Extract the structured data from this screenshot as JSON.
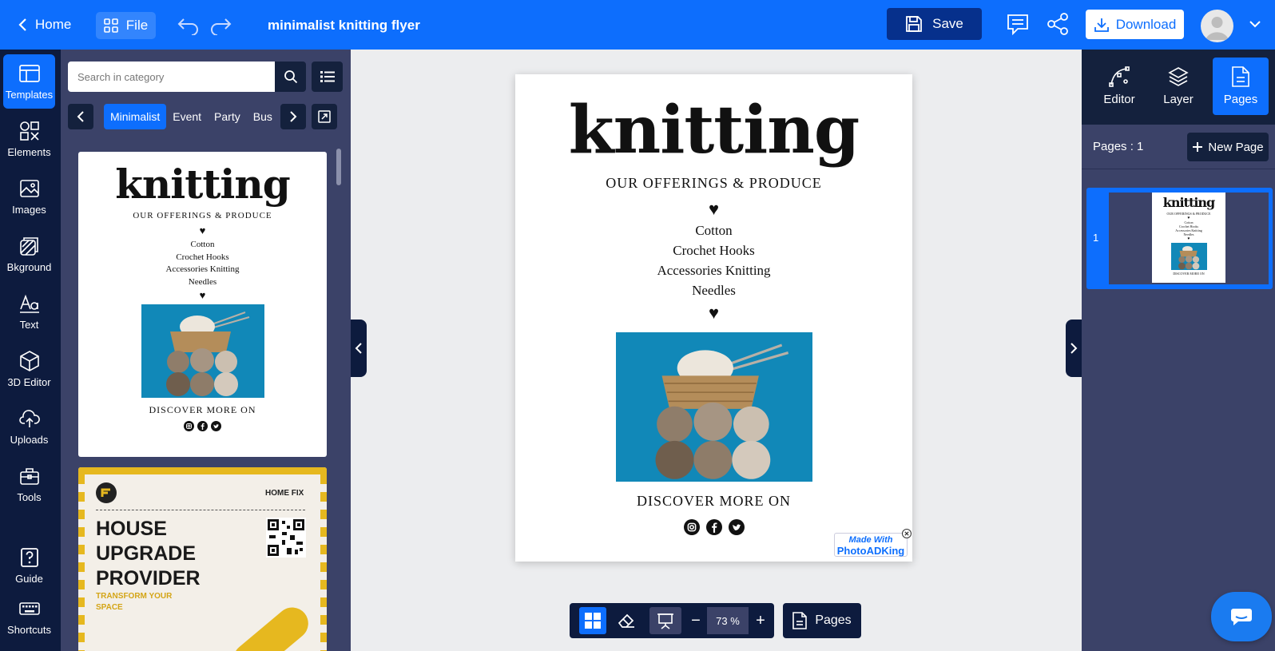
{
  "topbar": {
    "home_label": "Home",
    "file_label": "File",
    "doc_title": "minimalist knitting flyer",
    "save_label": "Save",
    "download_label": "Download"
  },
  "rail": {
    "items": [
      {
        "label": "Templates",
        "icon": "templates-icon"
      },
      {
        "label": "Elements",
        "icon": "elements-icon"
      },
      {
        "label": "Images",
        "icon": "images-icon"
      },
      {
        "label": "Bkground",
        "icon": "background-icon"
      },
      {
        "label": "Text",
        "icon": "text-icon"
      },
      {
        "label": "3D Editor",
        "icon": "cube-icon"
      },
      {
        "label": "Uploads",
        "icon": "upload-icon"
      },
      {
        "label": "Tools",
        "icon": "toolbox-icon"
      }
    ],
    "guide_label": "Guide",
    "shortcuts_label": "Shortcuts"
  },
  "panel": {
    "search_placeholder": "Search in category",
    "categories": [
      "Minimalist",
      "Event",
      "Party",
      "Bus"
    ],
    "card2": {
      "brand": "HOME FIX",
      "headline": [
        "HOUSE",
        "UPGRADE",
        "PROVIDER"
      ],
      "tagline": [
        "TRANSFORM YOUR",
        "SPACE"
      ]
    }
  },
  "flyer": {
    "title": "knitting",
    "subtitle": "OUR OFFERINGS & PRODUCE",
    "heart": "♥",
    "items": [
      "Cotton",
      "Crochet Hooks",
      "Accessories Knitting",
      "Needles"
    ],
    "cta": "DISCOVER MORE ON"
  },
  "watermark": {
    "line1": "Made With",
    "line2": "PhotoADKing"
  },
  "zoom": {
    "value": "73 %",
    "minus": "−",
    "plus": "+"
  },
  "pages_button_label": "Pages",
  "rpanel": {
    "tabs": [
      {
        "label": "Editor",
        "icon": "editor-icon"
      },
      {
        "label": "Layer",
        "icon": "layers-icon"
      },
      {
        "label": "Pages",
        "icon": "pages-icon"
      }
    ],
    "pages_count": "Pages : 1",
    "new_page_label": "New Page",
    "thumb_number": "1"
  },
  "colors": {
    "accent": "#0d6efd",
    "dark_navy": "#0d1b3e",
    "panel": "#3b4268",
    "save_button": "#06308c",
    "photo_bg": "#1188b8",
    "card_yellow": "#e6b81f"
  }
}
